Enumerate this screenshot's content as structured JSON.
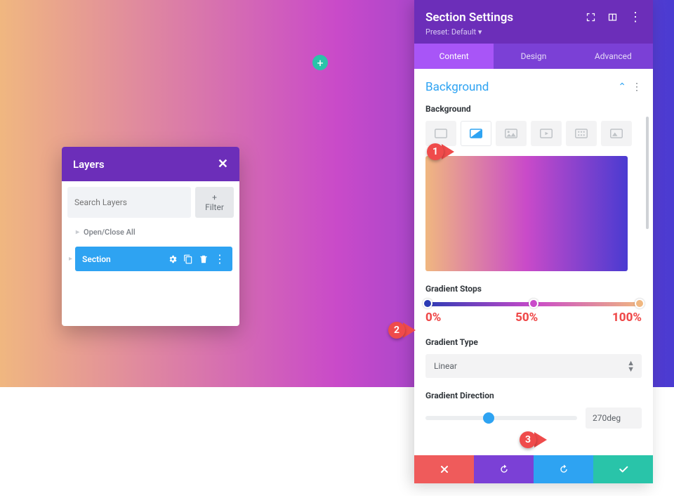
{
  "canvas": {
    "add_icon": "+"
  },
  "layers": {
    "title": "Layers",
    "search_placeholder": "Search Layers",
    "filter_label": "+  Filter",
    "open_close": "Open/Close All",
    "item_label": "Section"
  },
  "settings": {
    "title": "Section Settings",
    "preset_label": "Preset: Default ▾",
    "tabs": {
      "content": "Content",
      "design": "Design",
      "advanced": "Advanced"
    },
    "background_section": "Background",
    "background_label": "Background",
    "gradient_stops_label": "Gradient Stops",
    "stop_0": "0%",
    "stop_50": "50%",
    "stop_100": "100%",
    "gradient_type_label": "Gradient Type",
    "gradient_type_value": "Linear",
    "gradient_direction_label": "Gradient Direction",
    "gradient_direction_value": "270deg",
    "direction_thumb_pct": 38
  },
  "callouts": {
    "one": "1",
    "two": "2",
    "three": "3"
  },
  "colors": {
    "purple": "#6c2eb9",
    "tab_active": "#a855f7",
    "accent_blue": "#2ea3f2",
    "accent_red": "#ef4b4b",
    "accent_green": "#29c4a9"
  }
}
